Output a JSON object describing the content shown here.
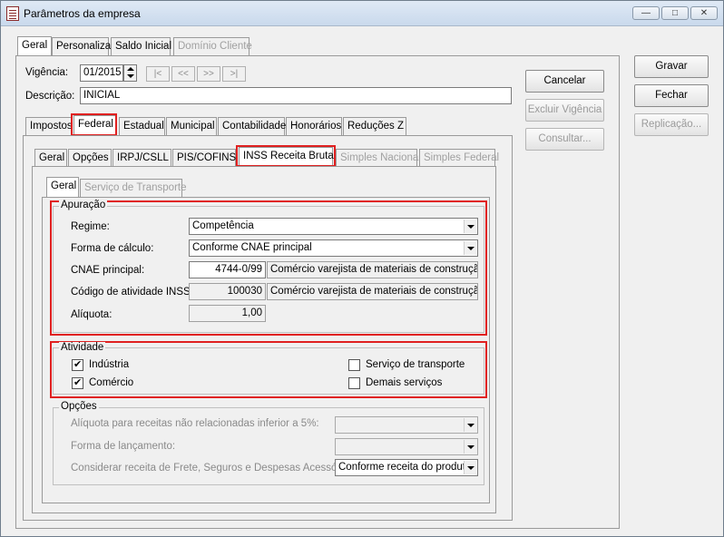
{
  "window": {
    "title": "Parâmetros da empresa",
    "minimize": "—",
    "maximize": "□",
    "close": "✕"
  },
  "top_tabs": [
    "Geral",
    "Personaliza",
    "Saldo Inicial",
    "Domínio Cliente"
  ],
  "form": {
    "vigencia_label": "Vigência:",
    "vigencia_value": "01/2015",
    "nav_first": "|<",
    "nav_prev": "<<",
    "nav_next": ">>",
    "nav_last": ">|",
    "descricao_label": "Descrição:",
    "descricao_value": "INICIAL"
  },
  "tax_tabs": [
    "Impostos",
    "Federal",
    "Estadual",
    "Municipal",
    "Contabilidade",
    "Honorários",
    "Reduções Z"
  ],
  "federal_tabs": [
    "Geral",
    "Opções",
    "IRPJ/CSLL",
    "PIS/COFINS",
    "INSS Receita Bruta",
    "Simples Nacional",
    "Simples Federal"
  ],
  "inss_tabs": [
    "Geral",
    "Serviço de Transporte"
  ],
  "apuracao": {
    "title": "Apuração",
    "regime_label": "Regime:",
    "regime_value": "Competência",
    "forma_calculo_label": "Forma de cálculo:",
    "forma_calculo_value": "Conforme CNAE principal",
    "cnae_label": "CNAE principal:",
    "cnae_code": "4744-0/99",
    "cnae_desc": "Comércio varejista de materiais de construção em",
    "codigo_inss_label": "Código de atividade INSS:",
    "codigo_inss_code": "100030",
    "codigo_inss_desc": "Comércio varejista de materiais de construção em",
    "aliquota_label": "Alíquota:",
    "aliquota_value": "1,00"
  },
  "atividade": {
    "title": "Atividade",
    "industria": {
      "label": "Indústria",
      "checked": true
    },
    "comercio": {
      "label": "Comércio",
      "checked": true
    },
    "servico_transporte": {
      "label": "Serviço de transporte",
      "checked": false
    },
    "demais_servicos": {
      "label": "Demais serviços",
      "checked": false
    }
  },
  "opcoes": {
    "title": "Opções",
    "aliquota_receitas_label": "Alíquota para receitas não relacionadas inferior a 5%:",
    "aliquota_receitas_value": "",
    "forma_lancamento_label": "Forma de lançamento:",
    "forma_lancamento_value": "",
    "considerar_receita_label": "Considerar receita de Frete, Seguros e Despesas Acessórias:",
    "considerar_receita_value": "Conforme receita do produto/"
  },
  "side_buttons": {
    "cancelar": "Cancelar",
    "excluir_vigencia": "Excluir Vigência",
    "consultar": "Consultar..."
  },
  "right_buttons": {
    "gravar": "Gravar",
    "fechar": "Fechar",
    "replicacao": "Replicação..."
  },
  "colors": {
    "highlight_border": "#e02020",
    "window_bg": "#f0f0f0"
  }
}
